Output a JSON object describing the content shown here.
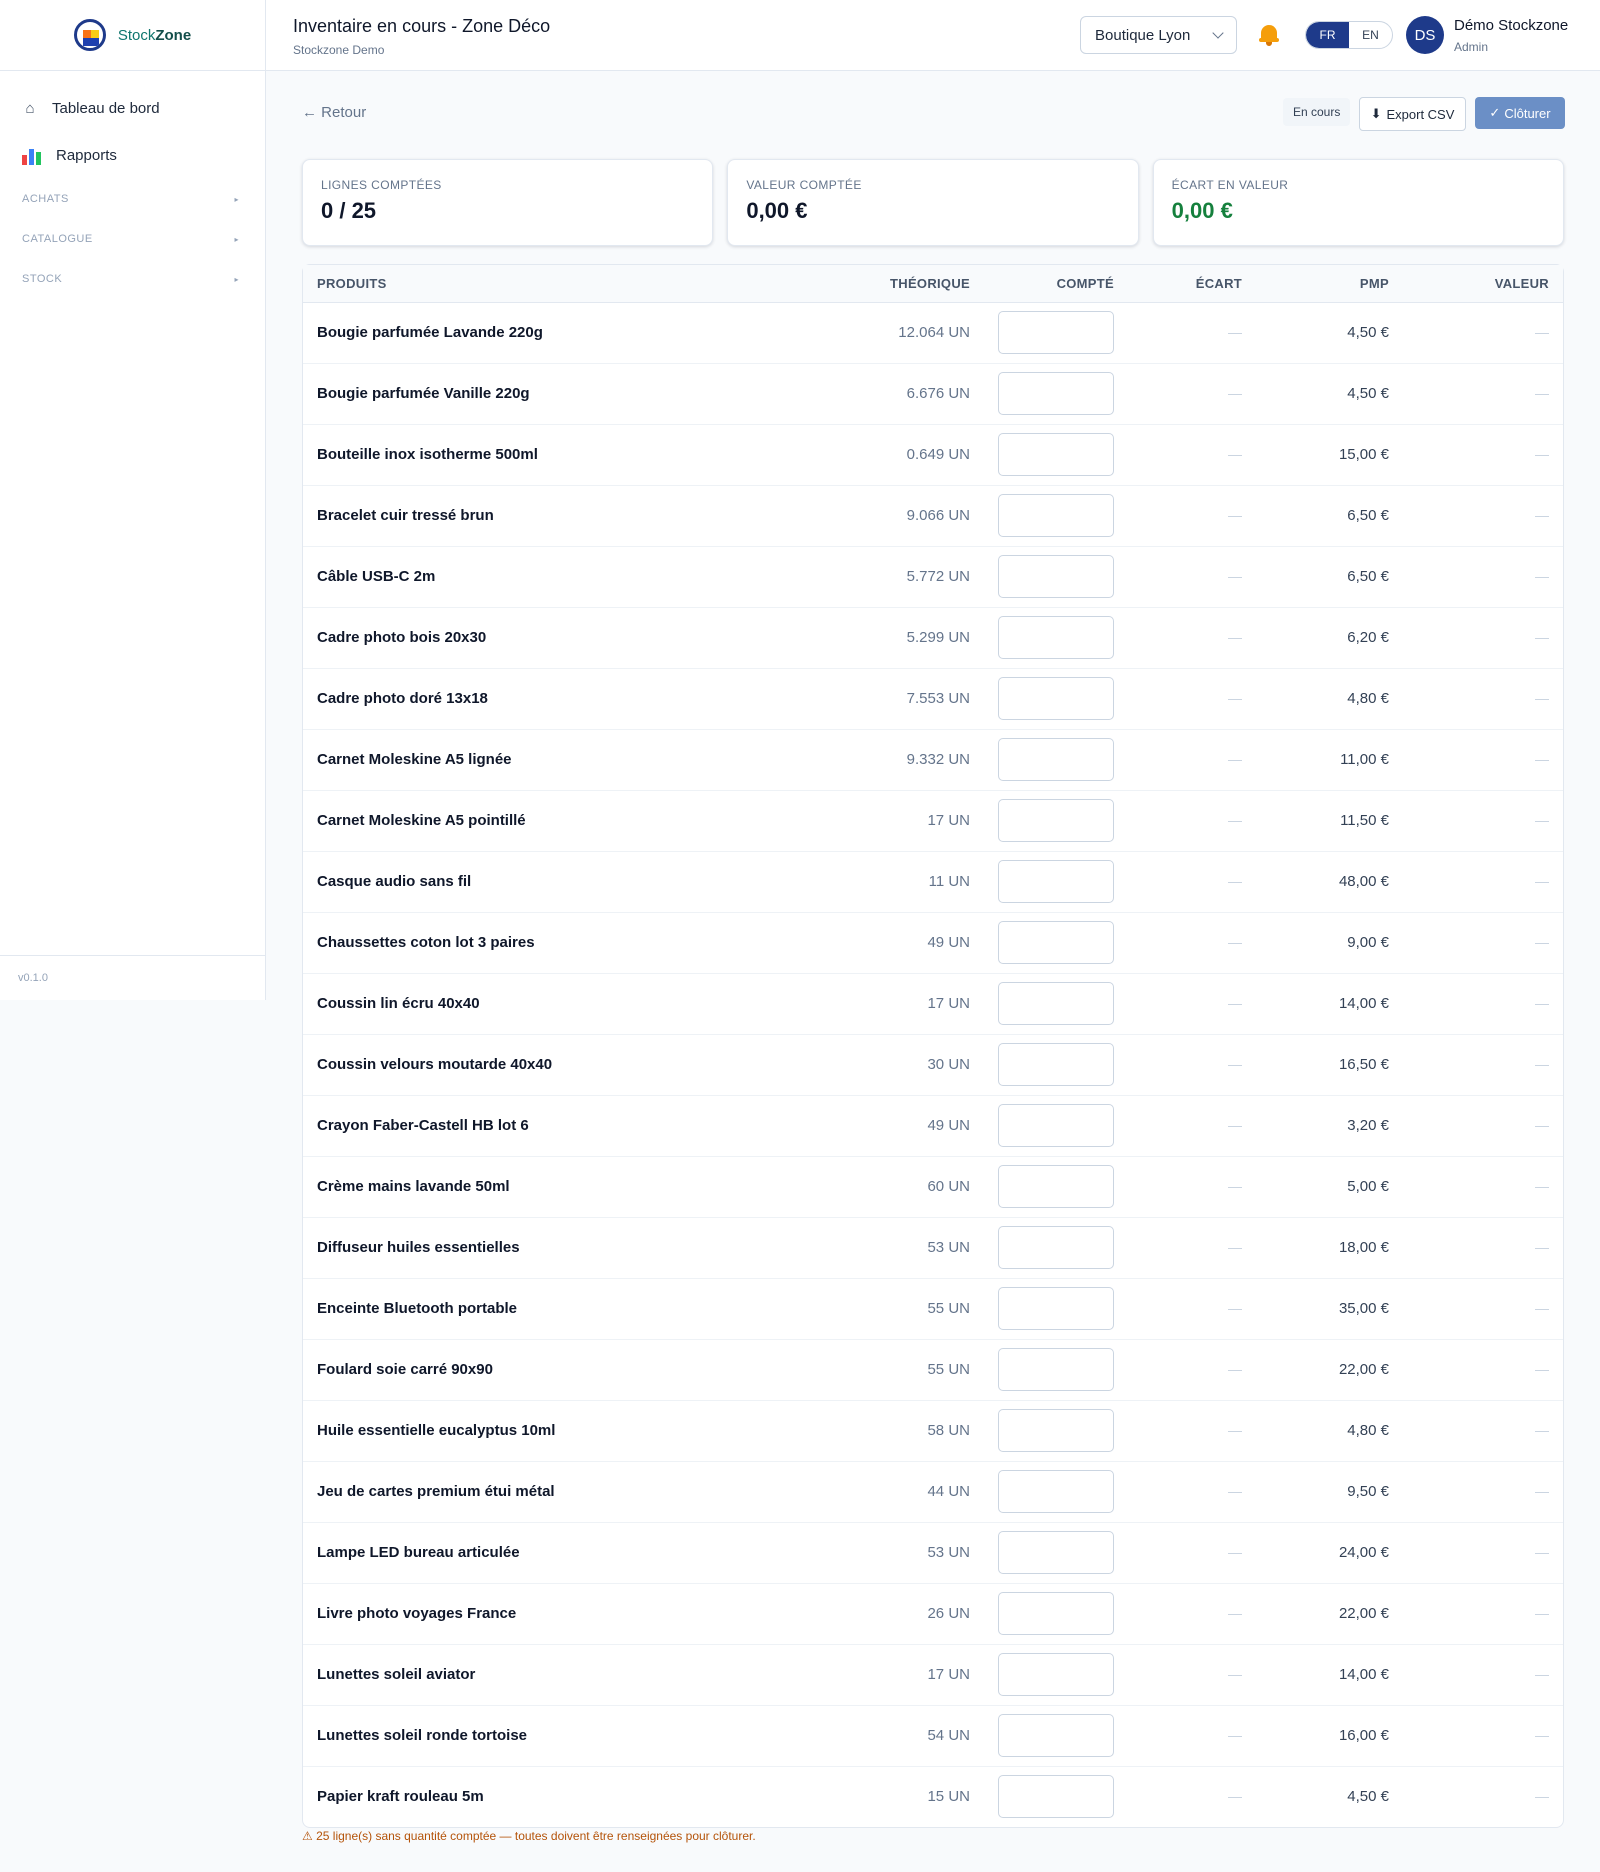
{
  "sidebar": {
    "logo": {
      "name_part1": "Stock",
      "name_part2": "Zone"
    },
    "nav": [
      {
        "label": "Tableau de bord",
        "icon": "home-icon"
      },
      {
        "label": "Rapports",
        "icon": "bar-chart-icon"
      }
    ],
    "sections": [
      {
        "label": "ACHATS"
      },
      {
        "label": "CATALOGUE"
      },
      {
        "label": "STOCK"
      }
    ],
    "version": "v0.1.0"
  },
  "header": {
    "title": "Inventaire en cours - Zone Déco",
    "subtitle": "Stockzone Demo",
    "store": "Boutique Lyon",
    "lang_active": "FR",
    "lang_other": "EN",
    "avatar_initials": "DS",
    "user_name": "Démo Stockzone",
    "user_role": "Admin"
  },
  "toolbar": {
    "back": "← Retour",
    "status": "En cours",
    "export": "Export CSV",
    "close": "Clôturer"
  },
  "stats": [
    {
      "label": "Lignes comptées",
      "value": "0 / 25"
    },
    {
      "label": "Valeur comptée",
      "value": "0,00 €"
    },
    {
      "label": "Écart en valeur",
      "value": "0,00 €"
    }
  ],
  "table": {
    "headers": {
      "product": "PRODUITS",
      "theoretical": "THÉORIQUE",
      "counted": "COMPTÉ",
      "gap": "ÉCART",
      "pmp": "PMP",
      "value": "VALEUR"
    },
    "rows": [
      {
        "product": "Bougie parfumée Lavande 220g",
        "theoretical": "12.064 UN",
        "pmp": "4,50 €"
      },
      {
        "product": "Bougie parfumée Vanille 220g",
        "theoretical": "6.676 UN",
        "pmp": "4,50 €"
      },
      {
        "product": "Bouteille inox isotherme 500ml",
        "theoretical": "0.649 UN",
        "pmp": "15,00 €"
      },
      {
        "product": "Bracelet cuir tressé brun",
        "theoretical": "9.066 UN",
        "pmp": "6,50 €"
      },
      {
        "product": "Câble USB-C 2m",
        "theoretical": "5.772 UN",
        "pmp": "6,50 €"
      },
      {
        "product": "Cadre photo bois 20x30",
        "theoretical": "5.299 UN",
        "pmp": "6,20 €"
      },
      {
        "product": "Cadre photo doré 13x18",
        "theoretical": "7.553 UN",
        "pmp": "4,80 €"
      },
      {
        "product": "Carnet Moleskine A5 lignée",
        "theoretical": "9.332 UN",
        "pmp": "11,00 €"
      },
      {
        "product": "Carnet Moleskine A5 pointillé",
        "theoretical": "17 UN",
        "pmp": "11,50 €"
      },
      {
        "product": "Casque audio sans fil",
        "theoretical": "11 UN",
        "pmp": "48,00 €"
      },
      {
        "product": "Chaussettes coton lot 3 paires",
        "theoretical": "49 UN",
        "pmp": "9,00 €"
      },
      {
        "product": "Coussin lin écru 40x40",
        "theoretical": "17 UN",
        "pmp": "14,00 €"
      },
      {
        "product": "Coussin velours moutarde 40x40",
        "theoretical": "30 UN",
        "pmp": "16,50 €"
      },
      {
        "product": "Crayon Faber-Castell HB lot 6",
        "theoretical": "49 UN",
        "pmp": "3,20 €"
      },
      {
        "product": "Crème mains lavande 50ml",
        "theoretical": "60 UN",
        "pmp": "5,00 €"
      },
      {
        "product": "Diffuseur huiles essentielles",
        "theoretical": "53 UN",
        "pmp": "18,00 €"
      },
      {
        "product": "Enceinte Bluetooth portable",
        "theoretical": "55 UN",
        "pmp": "35,00 €"
      },
      {
        "product": "Foulard soie carré 90x90",
        "theoretical": "55 UN",
        "pmp": "22,00 €"
      },
      {
        "product": "Huile essentielle eucalyptus 10ml",
        "theoretical": "58 UN",
        "pmp": "4,80 €"
      },
      {
        "product": "Jeu de cartes premium étui métal",
        "theoretical": "44 UN",
        "pmp": "9,50 €"
      },
      {
        "product": "Lampe LED bureau articulée",
        "theoretical": "53 UN",
        "pmp": "24,00 €"
      },
      {
        "product": "Livre photo voyages France",
        "theoretical": "26 UN",
        "pmp": "22,00 €"
      },
      {
        "product": "Lunettes soleil aviator",
        "theoretical": "17 UN",
        "pmp": "14,00 €"
      },
      {
        "product": "Lunettes soleil ronde tortoise",
        "theoretical": "54 UN",
        "pmp": "16,00 €"
      },
      {
        "product": "Papier kraft rouleau 5m",
        "theoretical": "15 UN",
        "pmp": "4,50 €"
      }
    ]
  },
  "warning": "⚠ 25 ligne(s) sans quantité comptée — toutes doivent être renseignées pour clôturer.",
  "colors": {
    "brand": "#1e3a8a",
    "positive": "#15803d",
    "warning": "#b45309",
    "close_button": "#6b8fc6"
  }
}
